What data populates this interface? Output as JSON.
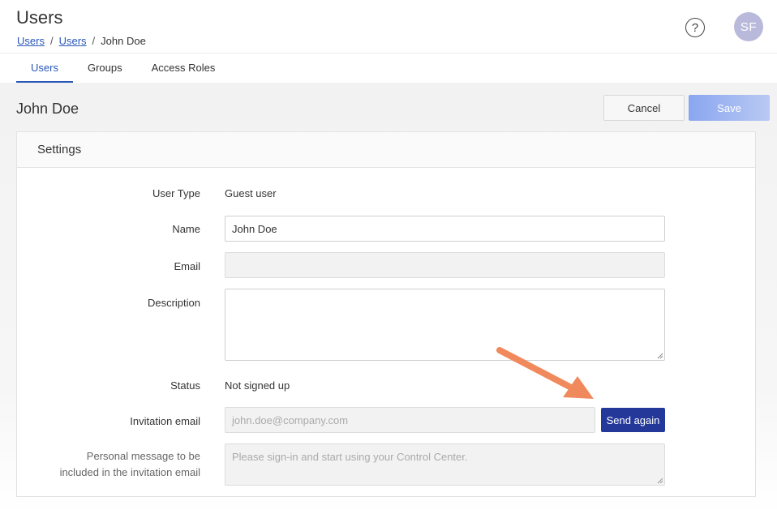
{
  "header": {
    "title": "Users",
    "breadcrumb": [
      "Users",
      "Users",
      "John Doe"
    ],
    "help_icon": "question-circle-icon",
    "avatar_initials": "SF"
  },
  "tabs": [
    {
      "label": "Users",
      "active": true
    },
    {
      "label": "Groups",
      "active": false
    },
    {
      "label": "Access Roles",
      "active": false
    }
  ],
  "record": {
    "title": "John Doe",
    "cancel_label": "Cancel",
    "save_label": "Save"
  },
  "settings": {
    "section_title": "Settings",
    "user_type_label": "User Type",
    "user_type_value": "Guest user",
    "name_label": "Name",
    "name_value": "John Doe",
    "email_label": "Email",
    "email_value": "",
    "description_label": "Description",
    "description_value": "",
    "status_label": "Status",
    "status_value": "Not signed up",
    "invitation_label": "Invitation email",
    "invitation_placeholder": "john.doe@company.com",
    "send_again_label": "Send again",
    "message_label_line1": "Personal message to be",
    "message_label_line2": "included in the invitation email",
    "message_placeholder": "Please sign-in and start using your Control Center."
  },
  "colors": {
    "accent": "#2a57b8",
    "primary_button": "#24389a",
    "save_disabled": "#a9bdf2",
    "arrow": "#f08a5d"
  }
}
